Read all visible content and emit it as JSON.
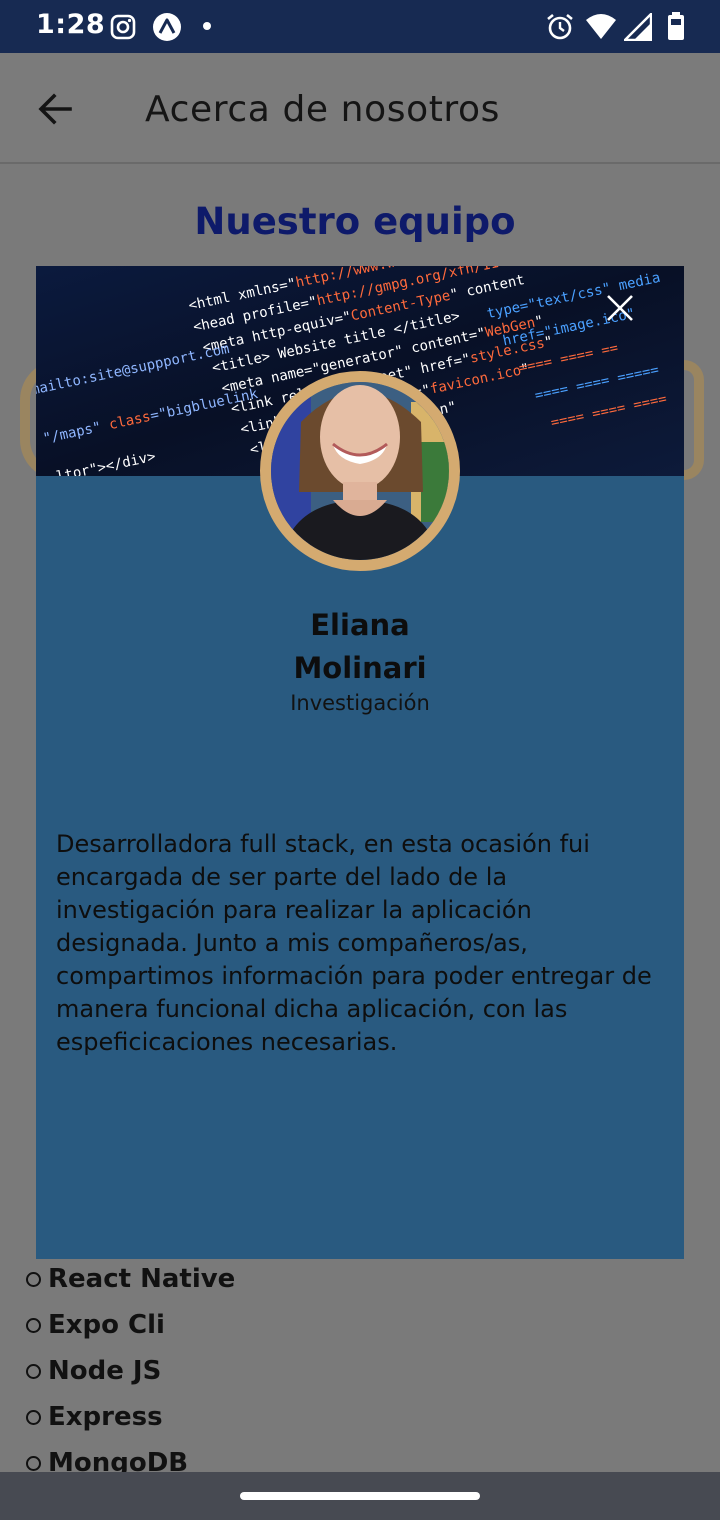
{
  "status_bar": {
    "time": "1:28",
    "left_icons": [
      "instagram-icon",
      "expo-icon",
      "notification-dot-icon"
    ],
    "right_icons": [
      "alarm-icon",
      "wifi-icon",
      "signal-icon",
      "battery-icon"
    ]
  },
  "app_bar": {
    "back_icon": "arrow-back-icon",
    "title": "Acerca de nosotros"
  },
  "page": {
    "heading": "Nuestro equipo",
    "tech_list": [
      "React Native",
      "Expo Cli",
      "Node JS",
      "Express",
      "MongoDB"
    ]
  },
  "modal": {
    "close_icon": "close-icon",
    "name_first": "Eliana",
    "name_last": "Molinari",
    "role": "Investigación",
    "bio": "Desarrolladora full stack, en esta ocasión fui encargada de ser parte del lado de la investigación para realizar la aplicación designada. Junto a mis compañeros/as, compartimos información para poder entregar de manera funcional dicha aplicación, con las espeficicaciones necesarias."
  },
  "colors": {
    "status_bar": "#172a52",
    "overlay": "#7a7a7a",
    "modal_bg": "#295a80",
    "heading": "#0e1a6a",
    "photo_border": "#d4aa70",
    "nav_bar": "#474a52"
  }
}
